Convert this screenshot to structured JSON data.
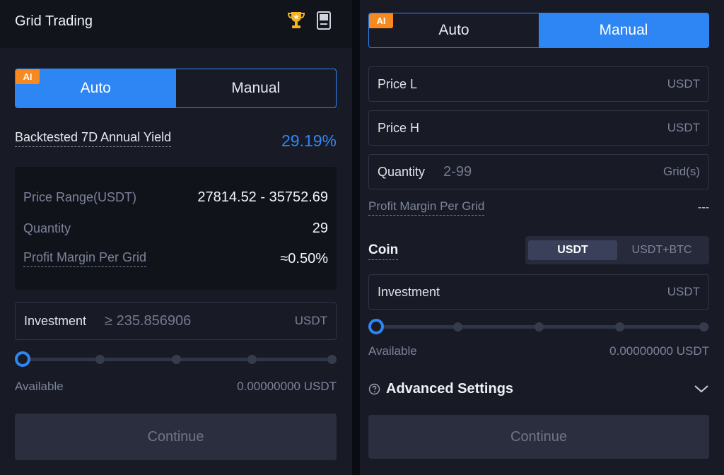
{
  "left": {
    "header": {
      "title": "Grid Trading"
    },
    "toggle": {
      "badge": "AI",
      "auto": "Auto",
      "manual": "Manual"
    },
    "yield": {
      "label": "Backtested 7D Annual Yield",
      "value": "29.19%"
    },
    "summary": {
      "price_range_label": "Price Range(USDT)",
      "price_range_value": "27814.52 - 35752.69",
      "quantity_label": "Quantity",
      "quantity_value": "29",
      "profit_label": "Profit Margin Per Grid",
      "profit_value": "≈0.50%"
    },
    "investment": {
      "label": "Investment",
      "placeholder": "≥ 235.856906",
      "unit": "USDT"
    },
    "slider": {
      "value_percent": 0,
      "stops": 5
    },
    "available": {
      "label": "Available",
      "value": "0.00000000 USDT"
    },
    "continue_label": "Continue"
  },
  "right": {
    "toggle": {
      "badge": "AI",
      "auto": "Auto",
      "manual": "Manual"
    },
    "price_low": {
      "label": "Price L",
      "unit": "USDT"
    },
    "price_high": {
      "label": "Price H",
      "unit": "USDT"
    },
    "quantity": {
      "label": "Quantity",
      "placeholder": "2-99",
      "unit": "Grid(s)"
    },
    "profit": {
      "label": "Profit Margin Per Grid",
      "value": "---"
    },
    "coin": {
      "label": "Coin",
      "options": [
        "USDT",
        "USDT+BTC"
      ],
      "selected": "USDT"
    },
    "investment": {
      "label": "Investment",
      "unit": "USDT"
    },
    "slider": {
      "value_percent": 0,
      "stops": 5
    },
    "available": {
      "label": "Available",
      "value": "0.00000000 USDT"
    },
    "advanced": {
      "label": "Advanced Settings"
    },
    "continue_label": "Continue"
  },
  "colors": {
    "accent": "#2e86f5",
    "ai_badge": "#f6891f",
    "panel_bg": "#181b26",
    "header_bg": "#12141c"
  },
  "icons": [
    "trophy-icon",
    "book-icon",
    "help-circle-icon",
    "chevron-down-icon"
  ]
}
